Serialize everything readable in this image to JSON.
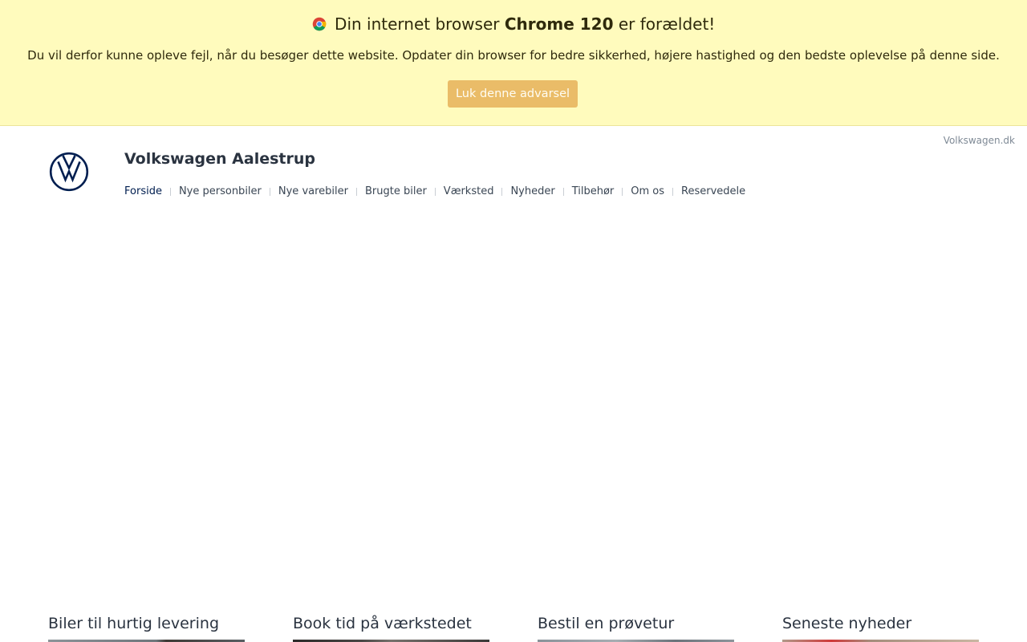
{
  "warning": {
    "title_prefix": "Din internet browser",
    "browser": "Chrome 120",
    "title_suffix": "er forældet!",
    "message": "Du vil derfor kunne opleve fejl, når du besøger dette website. Opdater din browser for bedre sikkerhed, højere hastighed og den bedste oplevelse på denne side.",
    "dismiss_label": "Luk denne advarsel"
  },
  "header": {
    "external_link": "Volkswagen.dk",
    "site_title": "Volkswagen Aalestrup",
    "nav": [
      {
        "label": "Forside",
        "active": true
      },
      {
        "label": "Nye personbiler"
      },
      {
        "label": "Nye varebiler"
      },
      {
        "label": "Brugte biler"
      },
      {
        "label": "Værksted"
      },
      {
        "label": "Nyheder"
      },
      {
        "label": "Tilbehør"
      },
      {
        "label": "Om os"
      },
      {
        "label": "Reservedele"
      }
    ]
  },
  "teasers": [
    {
      "title": "Biler til hurtig levering"
    },
    {
      "title": "Book tid på værkstedet"
    },
    {
      "title": "Bestil en prøvetur"
    },
    {
      "title": "Seneste nyheder"
    }
  ],
  "colors": {
    "banner_bg": "#fffbbd",
    "dismiss_bg": "#eabc68",
    "vw_blue": "#001e50"
  },
  "icons": {
    "browser": "chrome-icon",
    "brand": "vw-logo"
  }
}
